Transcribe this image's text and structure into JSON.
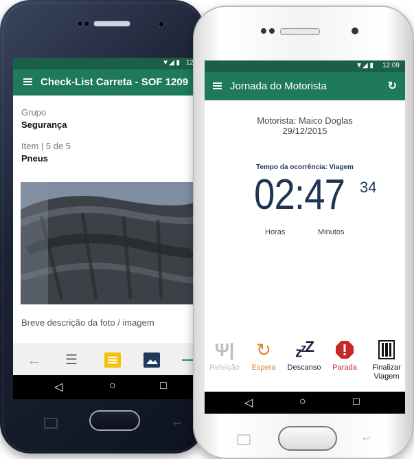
{
  "back_phone": {
    "status_time": "12",
    "toolbar_title": "Check-List Carreta - SOF 1209",
    "grupo_label": "Grupo",
    "grupo_value": "Segurança",
    "item_label": "Item | 5 de 5",
    "item_value": "Pneus",
    "photo_caption": "Breve descrição da foto / imagem",
    "bottom_bar_icons": [
      "back-arrow-icon",
      "list-icon",
      "comment-icon",
      "image-icon",
      "next-icon"
    ],
    "nav_icons": [
      "back-triangle-icon",
      "home-circle-icon",
      "recents-square-icon"
    ]
  },
  "front_phone": {
    "status_time": "12:09",
    "toolbar_title": "Jornada do Motorista",
    "driver_line": "Motorista: Maico Doglas",
    "date": "29/12/2015",
    "occurrence_label": "Tempo da ocorrência: Viagem",
    "timer_main": "02:47",
    "timer_seconds": "34",
    "hours_label": "Horas",
    "minutes_label": "Minutos",
    "actions": [
      {
        "label": "Refeição",
        "icon": "cutlery-icon",
        "color": "#bdbdbd"
      },
      {
        "label": "Espera",
        "icon": "clock-refresh-icon",
        "color": "#e67e22"
      },
      {
        "label": "Descanso",
        "icon": "sleep-zzz-icon",
        "color": "#1a1a3a"
      },
      {
        "label": "Parada",
        "icon": "stop-octagon-icon",
        "color": "#c62828"
      },
      {
        "label": "Finalizar Viagem",
        "icon": "finish-barcode-icon",
        "color": "#111111"
      }
    ],
    "nav_icons": [
      "back-triangle-icon",
      "home-circle-icon",
      "recents-square-icon"
    ]
  },
  "colors": {
    "toolbar": "#1f7a5c",
    "statusbar": "#1c5f49",
    "timer_text": "#1f3552",
    "accent_comment": "#f4c20d",
    "accent_image": "#1e3a5f"
  }
}
